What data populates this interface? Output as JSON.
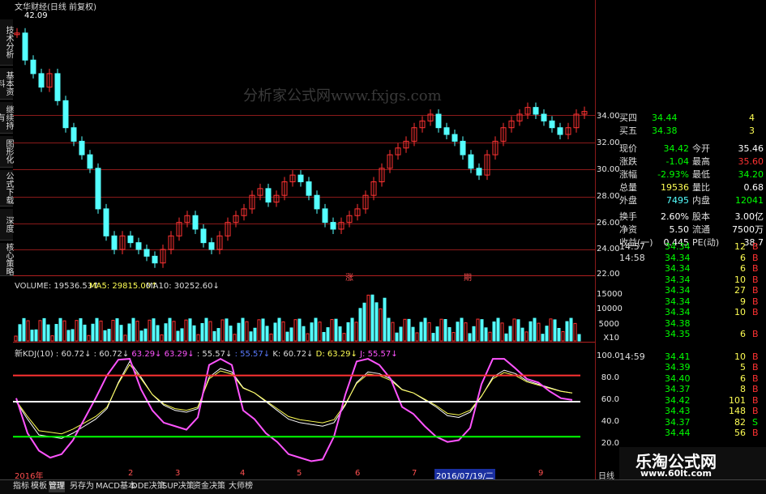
{
  "colors": {
    "up": "#ff3232",
    "down": "#54ffff",
    "white": "#ffffff",
    "yellow": "#ffff54",
    "magenta": "#ff54ff",
    "green": "#00ff00",
    "blue": "#5a7bff",
    "grid": "#8a1a1a"
  },
  "top_title": "文华财经(日线 前复权)",
  "chart_price_label": "42.09",
  "watermark": "分析家公式网www.fxjgs.com",
  "left_tabs": [
    "技术分析",
    "基本资料",
    "继续持有",
    "图形化",
    "公式下载",
    "深度",
    "核心策略"
  ],
  "price_axis": [
    "34.00",
    "32.00",
    "30.00",
    "28.00",
    "26.00",
    "24.00",
    "22.00"
  ],
  "price_markers": [
    "涨",
    "期"
  ],
  "volume": {
    "header": [
      "VOLUME: 19536.53↑",
      "MA5: 29815.00↑",
      "MA10: 30252.60↓"
    ],
    "axis": [
      "15000",
      "10000",
      "5000",
      "X10"
    ]
  },
  "kdj": {
    "header": [
      "新KDJ(10)",
      ": 60.72↓",
      ": 60.72↓",
      "63.29↓",
      "63.29↓",
      ": 55.57↓",
      ": 55.57↓",
      "K: 60.72↓",
      "D: 63.29↓",
      "J: 55.57↓"
    ],
    "axis": [
      "100.0",
      "80.0",
      "60.0",
      "40.0",
      "20.0"
    ],
    "k": [
      50,
      30,
      12,
      10,
      8,
      14,
      22,
      30,
      42,
      72,
      96,
      78,
      58,
      46,
      40,
      38,
      42,
      78,
      88,
      84,
      66,
      60,
      50,
      40,
      30,
      26,
      24,
      22,
      26,
      46,
      72,
      84,
      82,
      76,
      64,
      60,
      52,
      44,
      34,
      32,
      38,
      56,
      78,
      86,
      82,
      74,
      70,
      66,
      62,
      60
    ],
    "j": [
      54,
      14,
      -6,
      -14,
      -10,
      6,
      30,
      54,
      80,
      98,
      99,
      64,
      40,
      26,
      22,
      18,
      32,
      92,
      99,
      92,
      40,
      30,
      14,
      4,
      -10,
      -14,
      -18,
      -16,
      10,
      58,
      96,
      99,
      92,
      76,
      44,
      36,
      22,
      10,
      4,
      6,
      20,
      70,
      99,
      99,
      88,
      76,
      72,
      62,
      54,
      52
    ]
  },
  "date_axis": [
    "2016年",
    "2",
    "3",
    "4",
    "5",
    "6",
    "7",
    "2016/07/19/二",
    "9"
  ],
  "date_axis_right": "日线",
  "bottom_tabs": [
    "指标",
    "模板",
    "管理",
    "另存为",
    "MACD基本",
    "DDE决策",
    "SUP决策",
    "资金决策",
    "大师榜"
  ],
  "order_book": [
    {
      "label": "买四",
      "price": "34.44",
      "qty": "4"
    },
    {
      "label": "买五",
      "price": "34.38",
      "qty": "3"
    }
  ],
  "stats": [
    {
      "l1": "现价",
      "v1": "34.42",
      "l2": "今开",
      "v2": "35.46"
    },
    {
      "l1": "涨跌",
      "v1": "-1.04",
      "l2": "最高",
      "v2": "35.60"
    },
    {
      "l1": "涨幅",
      "v1": "-2.93%",
      "l2": "最低",
      "v2": "34.20"
    },
    {
      "l1": "总量",
      "v1": "19536",
      "l2": "量比",
      "v2": "0.68"
    },
    {
      "l1": "外盘",
      "v1": "7495",
      "l2": "内盘",
      "v2": "12041"
    },
    {
      "l1": "换手",
      "v1": "2.60%",
      "l2": "股本",
      "v2": "3.00亿"
    },
    {
      "l1": "净资",
      "v1": "5.50",
      "l2": "流通",
      "v2": "7500万"
    },
    {
      "l1": "收益(一)",
      "v1": "0.445",
      "l2": "PE(动)",
      "v2": "38.7"
    }
  ],
  "ticks": [
    {
      "t": "14:57",
      "p": "34.34",
      "v": "12",
      "s": "B"
    },
    {
      "t": "14:58",
      "p": "34.34",
      "v": "6",
      "s": "B"
    },
    {
      "t": "",
      "p": "34.34",
      "v": "6",
      "s": "B"
    },
    {
      "t": "",
      "p": "34.34",
      "v": "10",
      "s": "B"
    },
    {
      "t": "",
      "p": "34.34",
      "v": "27",
      "s": "B"
    },
    {
      "t": "",
      "p": "34.34",
      "v": "9",
      "s": "B"
    },
    {
      "t": "",
      "p": "34.34",
      "v": "10",
      "s": "B"
    },
    {
      "t": "",
      "p": "34.38",
      "v": "",
      "s": ""
    },
    {
      "t": "",
      "p": "34.35",
      "v": "6",
      "s": "B"
    },
    {
      "t": "14:59",
      "p": "34.41",
      "v": "10",
      "s": "B"
    },
    {
      "t": "",
      "p": "34.39",
      "v": "5",
      "s": "B"
    },
    {
      "t": "",
      "p": "34.40",
      "v": "6",
      "s": "B"
    },
    {
      "t": "",
      "p": "34.37",
      "v": "8",
      "s": "B"
    },
    {
      "t": "",
      "p": "34.42",
      "v": "101",
      "s": "B"
    },
    {
      "t": "",
      "p": "34.43",
      "v": "148",
      "s": "B"
    },
    {
      "t": "",
      "p": "34.37",
      "v": "82",
      "s": "S"
    },
    {
      "t": "",
      "p": "34.44",
      "v": "56",
      "s": "B"
    }
  ],
  "brand": {
    "name": "乐淘公式网",
    "url": "www.60lt.com"
  }
}
